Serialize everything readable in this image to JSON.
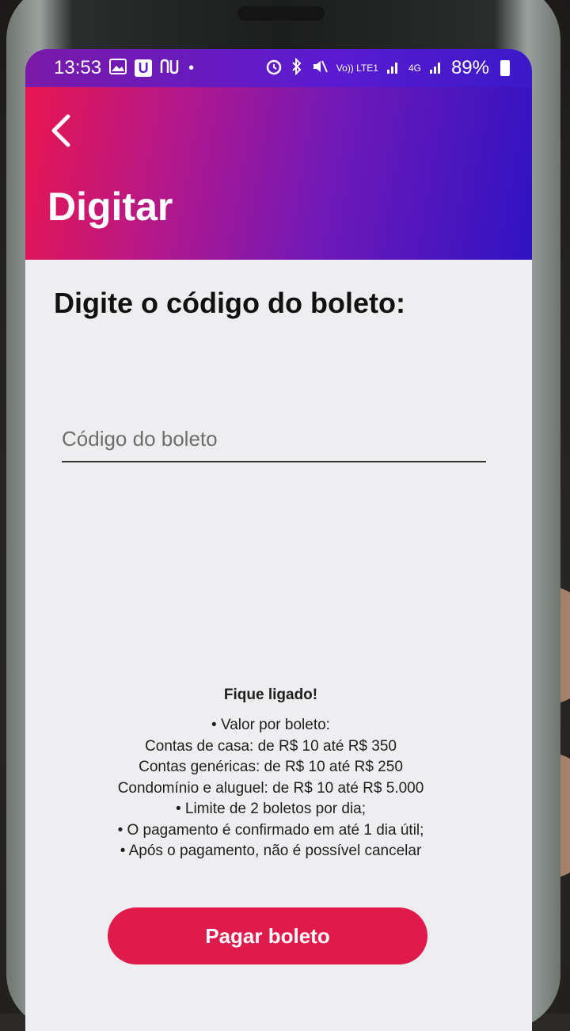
{
  "status_bar": {
    "time": "13:53",
    "left_icons": [
      "image-icon",
      "u-app-icon",
      "nubank-icon",
      "dot-icon"
    ],
    "right_icons": [
      "alarm-icon",
      "bluetooth-icon",
      "mute-icon",
      "volte-icon",
      "signal-icon",
      "4g-icon",
      "signal-icon"
    ],
    "volte_label": "Vo)) LTE1",
    "network_label": "4G",
    "battery": "89%"
  },
  "header": {
    "title": "Digitar",
    "back_icon": "chevron-left-icon",
    "gradient_colors": [
      "#e8164f",
      "#6f19b8",
      "#2f13c2"
    ]
  },
  "main": {
    "heading": "Digite o código do boleto:",
    "code_input": {
      "value": "",
      "placeholder": "Código do boleto"
    },
    "info": {
      "title": "Fique ligado!",
      "lines": [
        "• Valor por boleto:",
        "Contas de casa: de R$ 10 até R$ 350",
        "Contas genéricas: de R$ 10 até R$ 250",
        "Condomínio e aluguel: de R$ 10 até R$ 5.000",
        "• Limite de 2 boletos por dia;",
        "• O pagamento é confirmado em até 1 dia útil;",
        "• Após o pagamento, não é possível cancelar"
      ]
    },
    "pay_button_label": "Pagar boleto",
    "accent_color": "#e01a4b"
  }
}
